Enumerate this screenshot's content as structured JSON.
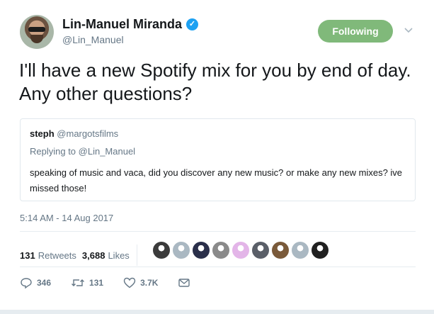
{
  "header": {
    "avatar_icon": "profile-photo-lin-manuel",
    "display_name": "Lin-Manuel Miranda",
    "verified_icon": "verified-badge-icon",
    "handle": "@Lin_Manuel",
    "follow_label": "Following",
    "caret_icon": "chevron-down-icon"
  },
  "tweet": {
    "text": "I'll have a new Spotify mix for you by end of day. Any other questions?"
  },
  "quoted": {
    "name": "steph",
    "handle": "@margotsfilms",
    "replying_to": "Replying to @Lin_Manuel",
    "text": "speaking of music and vaca, did you discover any new music? or make any new mixes? ive missed those!"
  },
  "timestamp": "5:14 AM - 14 Aug 2017",
  "stats": {
    "retweets_count": "131",
    "retweets_label": "Retweets",
    "likes_count": "3,688",
    "likes_label": "Likes",
    "liker_avatar_colors": [
      "#3b3b3b",
      "#aab8c2",
      "#2a2f4a",
      "#8a8a8a",
      "#e3b5e8",
      "#5a5f68",
      "#7a5a3a",
      "#aab8c2",
      "#202020"
    ]
  },
  "actions": {
    "reply_icon": "reply-icon",
    "reply_count": "346",
    "retweet_icon": "retweet-icon",
    "retweet_count": "131",
    "like_icon": "heart-icon",
    "like_count": "3.7K",
    "message_icon": "envelope-icon"
  },
  "colors": {
    "following_button": "#80b97a",
    "verified": "#1da1f2",
    "muted_text": "#657786"
  }
}
